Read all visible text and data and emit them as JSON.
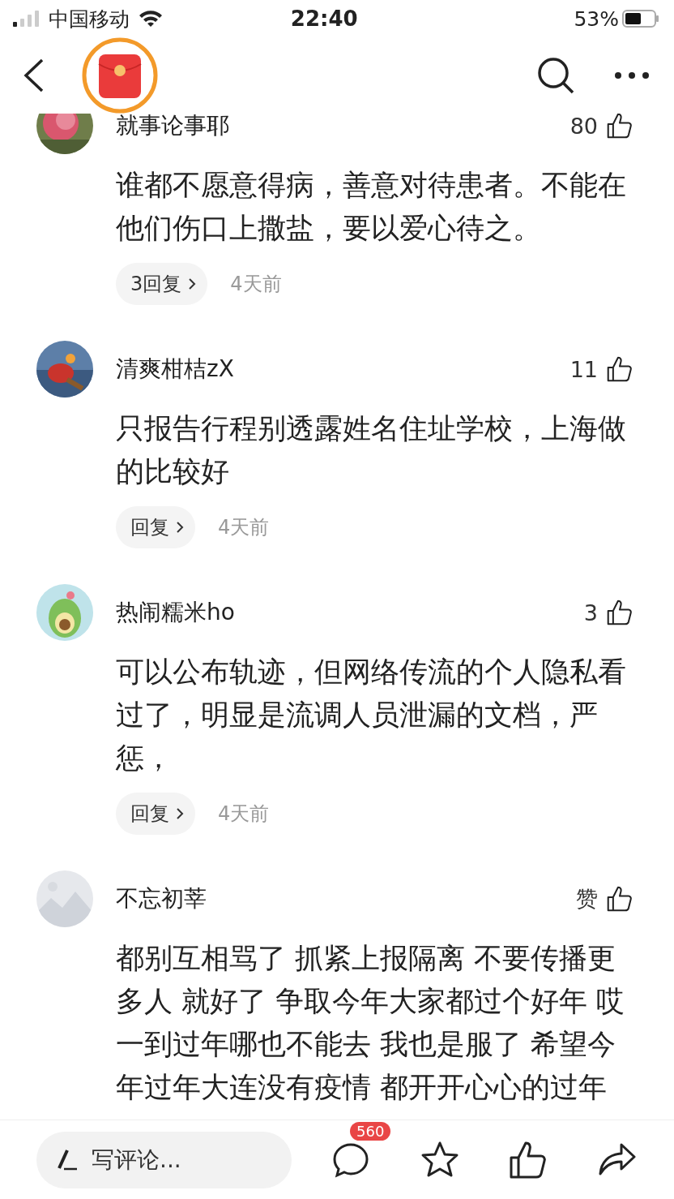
{
  "status_bar": {
    "carrier": "中国移动",
    "time": "22:40",
    "battery": "53%"
  },
  "comments": [
    {
      "author": "就事论事耶",
      "likes": "80",
      "text": "谁都不愿意得病，善意对待患者。不能在他们伤口上撒盐，要以爱心待之。",
      "replies": "3回复",
      "time": "4天前"
    },
    {
      "author": "清爽柑桔zX",
      "likes": "11",
      "text": "只报告行程别透露姓名住址学校，上海做的比较好",
      "replies": "回复",
      "time": "4天前"
    },
    {
      "author": "热闹糯米ho",
      "likes": "3",
      "text": "可以公布轨迹，但网络传流的个人隐私看过了，明显是流调人员泄漏的文档，严惩，",
      "replies": "回复",
      "time": "4天前"
    },
    {
      "author": "不忘初莘",
      "likes": "赞",
      "text": "都别互相骂了 抓紧上报隔离 不要传播更多人 就好了 争取今年大家都过个好年 哎一到过年哪也不能去 我也是服了 希望今年过年大连没有疫情 都开开心心的过年"
    }
  ],
  "bottom_bar": {
    "placeholder": "写评论...",
    "comment_count": "560"
  }
}
